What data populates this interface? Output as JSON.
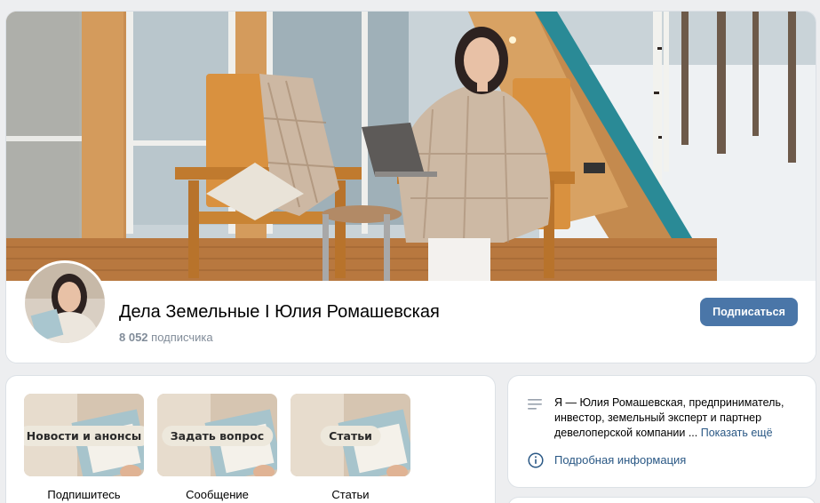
{
  "header": {
    "group_name": "Дела Земельные I Юлия Ромашевская",
    "followers_count": "8 052",
    "followers_label": "подписчика",
    "subscribe_label": "Подписаться"
  },
  "quick_links": [
    {
      "tile_text": "Новости и анонсы",
      "caption": "Подпишитесь"
    },
    {
      "tile_text": "Задать вопрос",
      "caption": "Сообщение"
    },
    {
      "tile_text": "Статьи",
      "caption": "Статьи"
    }
  ],
  "about": {
    "text": "Я — Юлия Ромашевская, предприниматель, инвестор, земельный эксперт и партнер девелоперской компании ...",
    "show_more": "Показать ещё",
    "details_link": "Подробная информация"
  },
  "colors": {
    "accent": "#4a76a8",
    "link": "#2a5885",
    "muted": "#818c99",
    "background": "#edeef0"
  },
  "icons": {
    "about": "text-lines-icon",
    "details": "info-circle-icon"
  }
}
